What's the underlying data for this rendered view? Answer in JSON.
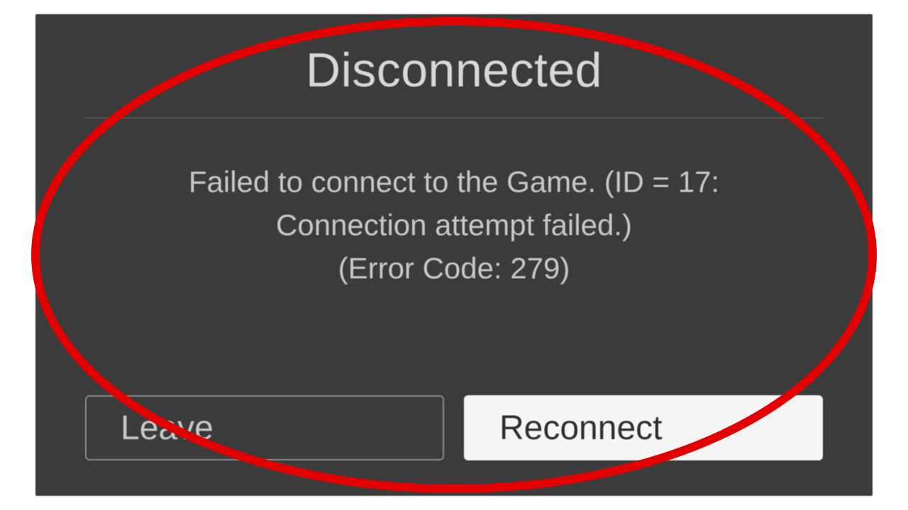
{
  "dialog": {
    "title": "Disconnected",
    "message_line1": "Failed to connect to the Game. (ID = 17:",
    "message_line2": "Connection attempt failed.)",
    "message_line3": "(Error Code: 279)",
    "leave_label": "Leave",
    "reconnect_label": "Reconnect"
  },
  "annotation": {
    "ellipse_color": "#e20000",
    "ellipse_stroke_width": 12
  }
}
